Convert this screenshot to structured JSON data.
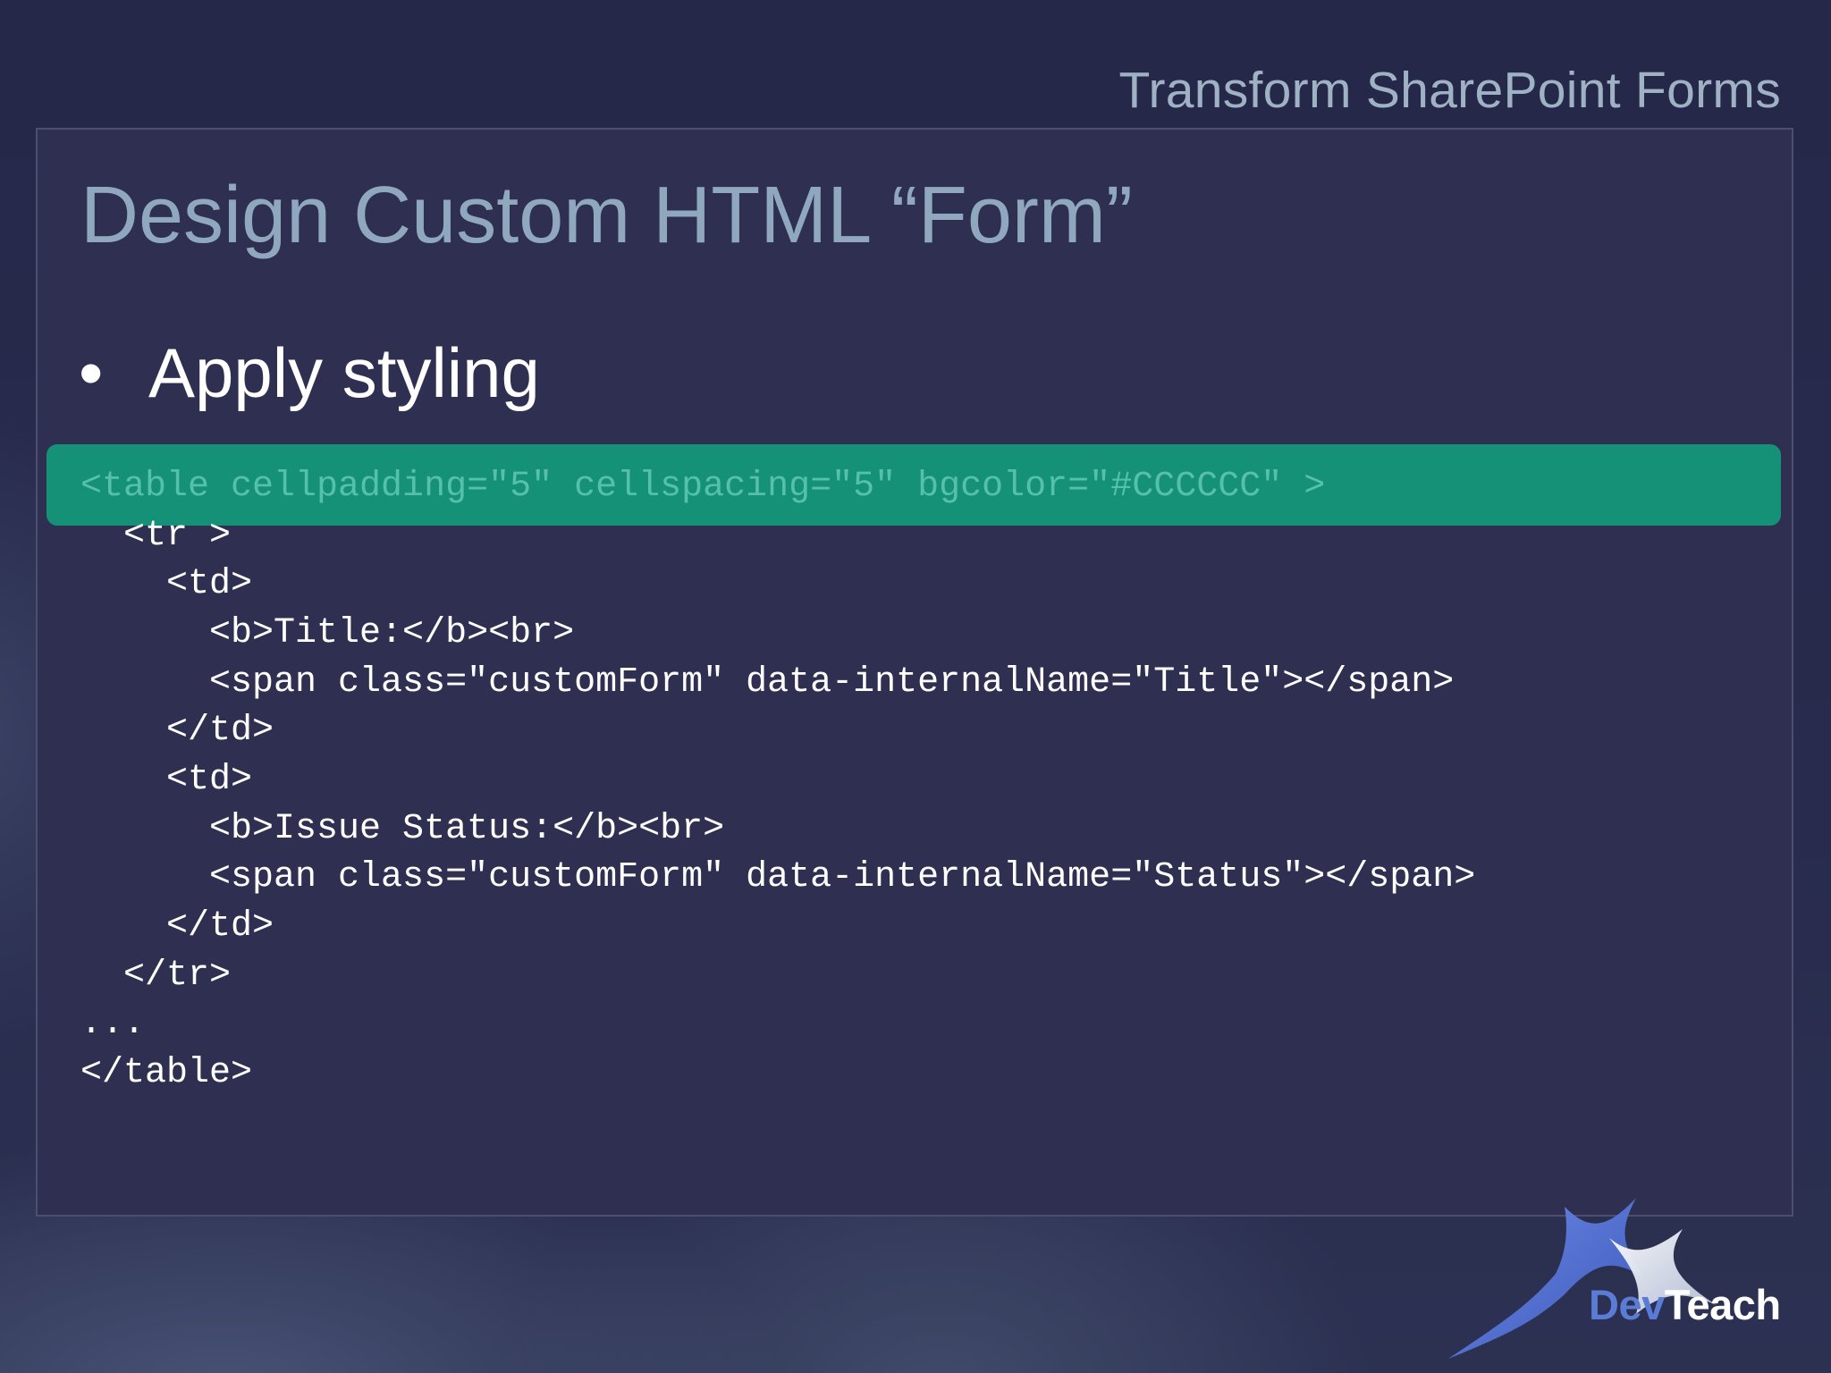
{
  "header": {
    "title": "Transform SharePoint Forms"
  },
  "slide": {
    "title": "Design Custom HTML “Form”",
    "bullet_symbol": "•",
    "bullet": "Apply styling"
  },
  "code": {
    "lines": [
      "<table cellpadding=\"5\" cellspacing=\"5\" bgcolor=\"#CCCCCC\" >",
      "  <tr >",
      "    <td>",
      "      <b>Title:</b><br>",
      "      <span class=\"customForm\" data-internalName=\"Title\"></span>",
      "    </td>",
      "    <td>",
      "      <b>Issue Status:</b><br>",
      "      <span class=\"customForm\" data-internalName=\"Status\"></span>",
      "    </td>",
      "  </tr>",
      "...",
      "</table>"
    ]
  },
  "logo": {
    "part1": "Dev",
    "part2": "Teach"
  },
  "colors": {
    "highlight": "#159178",
    "highlight_text": "#56c0aa",
    "title": "#8fa8be",
    "header": "#9fb2c3",
    "panel": "#2f3051"
  }
}
